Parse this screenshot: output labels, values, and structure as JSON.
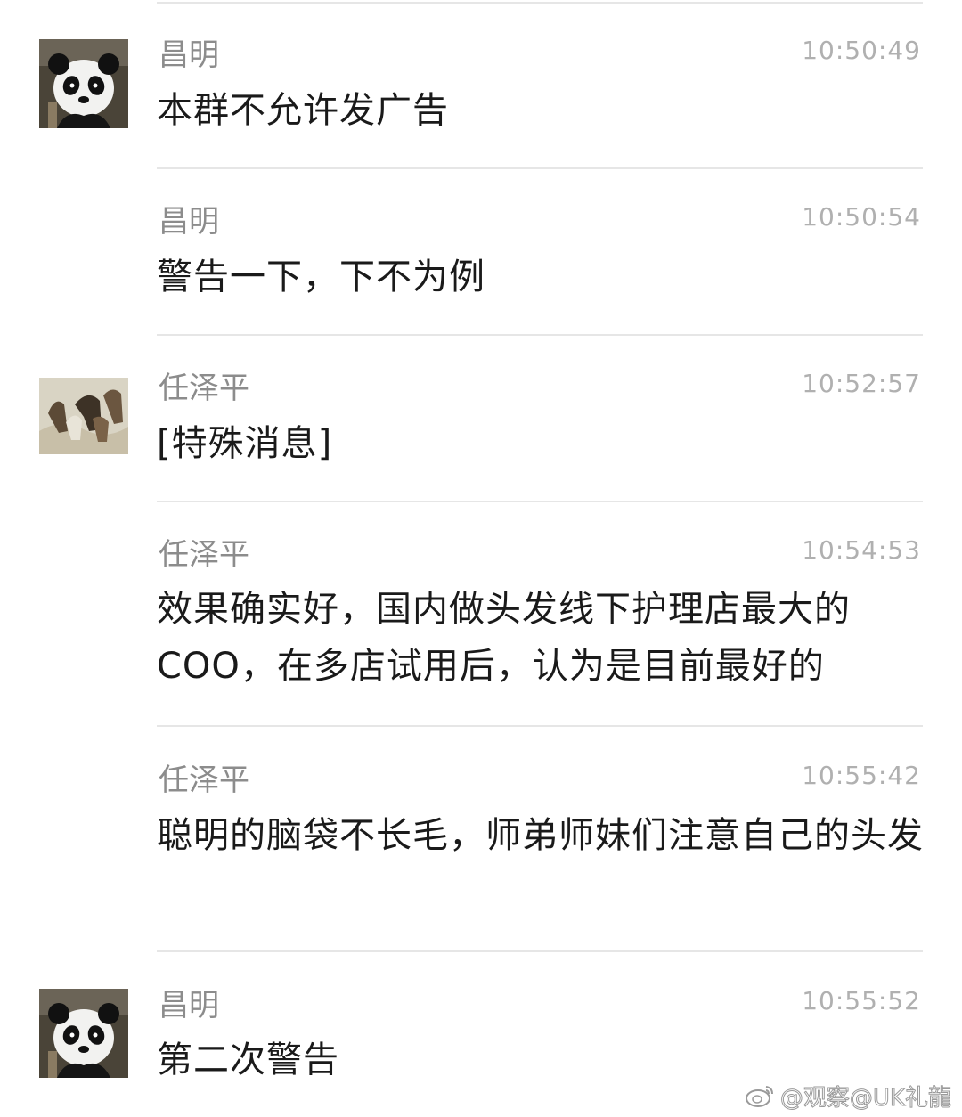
{
  "messages": [
    {
      "sender": "昌明",
      "time": "10:50:49",
      "text": "本群不允许发广告",
      "avatar": "panda-avatar"
    },
    {
      "sender": "昌明",
      "time": "10:50:54",
      "text": "警告一下，下不为例",
      "avatar": ""
    },
    {
      "sender": "任泽平",
      "time": "10:52:57",
      "text": "[特殊消息]",
      "avatar": "horses-painting-avatar"
    },
    {
      "sender": "任泽平",
      "time": "10:54:53",
      "text": "效果确实好，国内做头发线下护理店最大的COO，在多店试用后，认为是目前最好的",
      "avatar": ""
    },
    {
      "sender": "任泽平",
      "time": "10:55:42",
      "text": "聪明的脑袋不长毛，师弟师妹们注意自己的头发",
      "avatar": ""
    },
    {
      "sender": "昌明",
      "time": "10:55:52",
      "text": "第二次警告",
      "avatar": "panda-avatar"
    }
  ],
  "watermark": {
    "text": "@观察@UK礼龍",
    "icon": "weibo-icon"
  }
}
